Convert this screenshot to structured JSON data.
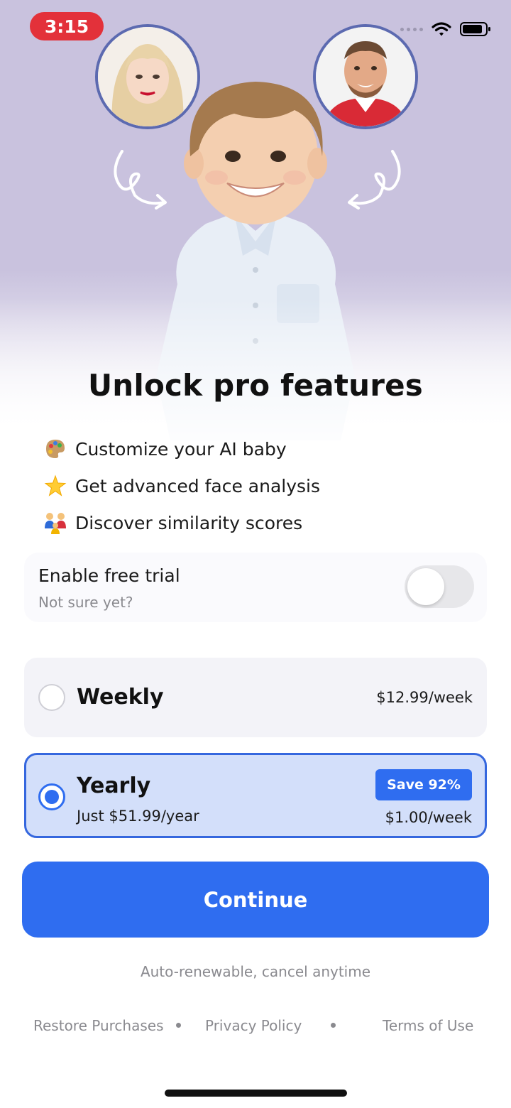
{
  "status_bar": {
    "time": "3:15"
  },
  "hero": {
    "left_photo": "parent-photo-woman",
    "right_photo": "parent-photo-man",
    "center_photo": "ai-baby-photo"
  },
  "title": "Unlock pro features",
  "features": [
    {
      "icon": "palette-icon",
      "label": "Customize your AI baby"
    },
    {
      "icon": "sparkle-star-icon",
      "label": "Get advanced face analysis"
    },
    {
      "icon": "family-icon",
      "label": "Discover similarity scores"
    }
  ],
  "trial": {
    "title": "Enable free trial",
    "subtitle": "Not sure yet?",
    "enabled": false
  },
  "plans": [
    {
      "name": "Weekly",
      "price": "$12.99/week",
      "selected": false
    },
    {
      "name": "Yearly",
      "subtitle": "Just $51.99/year",
      "badge": "Save 92%",
      "price": "$1.00/week",
      "selected": true
    }
  ],
  "cta": {
    "label": "Continue"
  },
  "renew_note": "Auto-renewable, cancel anytime",
  "footer": {
    "restore": "Restore Purchases",
    "privacy": "Privacy Policy",
    "terms": "Terms of Use"
  },
  "colors": {
    "accent": "#2f6df0",
    "hero_bg": "#c9c2de",
    "selected_plan_bg": "#d3dffa",
    "status_time_bg": "#e3313a"
  }
}
